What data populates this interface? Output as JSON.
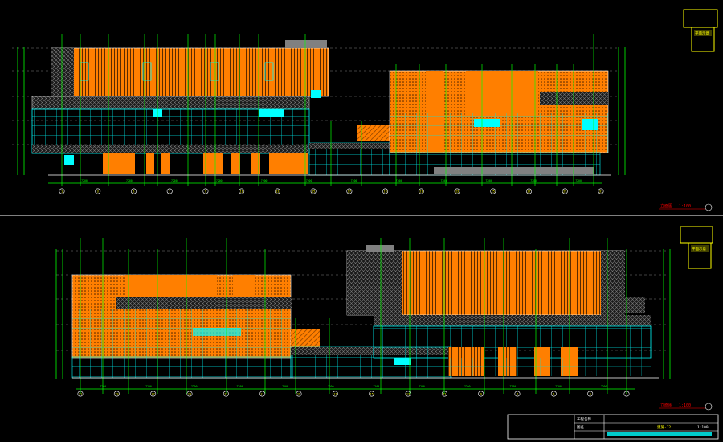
{
  "drawing": {
    "background": "#000000",
    "colors": {
      "orange": "#ff7f00",
      "cyan": "#00ffff",
      "green": "#00ff00",
      "yellow": "#ffff00",
      "white": "#ffffff",
      "grey": "#808080",
      "red": "#ff0000"
    }
  },
  "elevations": [
    {
      "id": "upper",
      "caption": "立面图",
      "caption_scale": "1:100",
      "inset_label": "平面示意",
      "axis_labels": [
        "1",
        "3",
        "5",
        "7",
        "9",
        "11",
        "13",
        "15",
        "17",
        "19",
        "21",
        "23",
        "25",
        "27",
        "29",
        "31"
      ],
      "dimension_labels": [
        "7200",
        "7200",
        "7200",
        "7200",
        "7200",
        "7200",
        "7200",
        "7200",
        "7200",
        "7200",
        "7200",
        "7200"
      ]
    },
    {
      "id": "lower",
      "caption": "立面图",
      "caption_scale": "1:100",
      "inset_label": "平面示意",
      "axis_labels": [
        "31",
        "29",
        "27",
        "25",
        "23",
        "21",
        "19",
        "17",
        "15",
        "13",
        "11",
        "9",
        "7",
        "5",
        "3",
        "1"
      ],
      "dimension_labels": [
        "7200",
        "7200",
        "7200",
        "7200",
        "7200",
        "7200",
        "7200",
        "7200",
        "7200",
        "7200",
        "7200",
        "7200"
      ]
    }
  ],
  "title_block": {
    "project_label": "工程名称",
    "drawing_label": "图名",
    "drawing_no": "建施-12",
    "scale": "1:100"
  }
}
